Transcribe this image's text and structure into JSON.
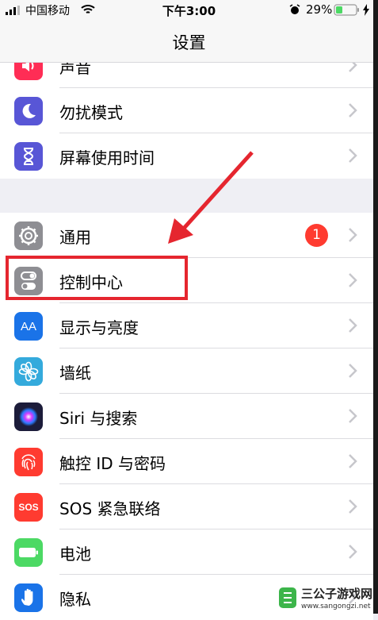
{
  "status_bar": {
    "carrier": "中国移动",
    "time": "下午3:00",
    "battery": "29%"
  },
  "nav": {
    "title": "设置"
  },
  "items": [
    {
      "label": "声音",
      "icon": "speaker-icon",
      "color": "#ff2d55"
    },
    {
      "label": "勿扰模式",
      "icon": "moon-icon",
      "color": "#5856d6"
    },
    {
      "label": "屏幕使用时间",
      "icon": "hourglass-icon",
      "color": "#5856d6"
    },
    {
      "label": "通用",
      "icon": "gear-icon",
      "color": "#8e8e93",
      "badge": "1"
    },
    {
      "label": "控制中心",
      "icon": "toggles-icon",
      "color": "#8e8e93"
    },
    {
      "label": "显示与亮度",
      "icon": "aa-icon",
      "color": "#1a73e8",
      "icon_text": "AA"
    },
    {
      "label": "墙纸",
      "icon": "flower-icon",
      "color": "#34aadc"
    },
    {
      "label": "Siri 与搜索",
      "icon": "siri-icon",
      "color": "#1c1c3a"
    },
    {
      "label": "触控 ID 与密码",
      "icon": "fingerprint-icon",
      "color": "#ff3b30"
    },
    {
      "label": "SOS 紧急联络",
      "icon": "sos-icon",
      "color": "#ff3b30",
      "icon_text": "SOS"
    },
    {
      "label": "电池",
      "icon": "battery-icon",
      "color": "#4cd964"
    },
    {
      "label": "隐私",
      "icon": "hand-icon",
      "color": "#1a73e8"
    }
  ],
  "watermark": {
    "title": "三公子游戏网",
    "url": "www.sangongzi.net"
  }
}
